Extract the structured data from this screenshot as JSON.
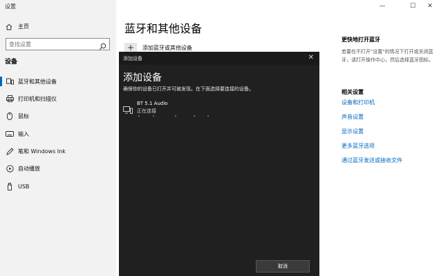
{
  "window": {
    "title": "设置",
    "controls": [
      "—",
      "☐",
      "✕"
    ]
  },
  "sidebar": {
    "home_label": "主页",
    "search_placeholder": "查找设置",
    "category": "设备",
    "items": [
      {
        "label": "蓝牙和其他设备",
        "icon": "bluetooth-devices-icon",
        "active": true
      },
      {
        "label": "打印机和扫描仪",
        "icon": "printer-icon",
        "active": false
      },
      {
        "label": "鼠标",
        "icon": "mouse-icon",
        "active": false
      },
      {
        "label": "输入",
        "icon": "keyboard-icon",
        "active": false
      },
      {
        "label": "笔和 Windows Ink",
        "icon": "pen-icon",
        "active": false
      },
      {
        "label": "自动播放",
        "icon": "autoplay-icon",
        "active": false
      },
      {
        "label": "USB",
        "icon": "usb-icon",
        "active": false
      }
    ]
  },
  "main": {
    "title": "蓝牙和其他设备",
    "add_device_label": "添加蓝牙或其他设备"
  },
  "side_panel": {
    "heading": "更快地打开蓝牙",
    "description": "若要在不打开\"设置\"的情况下打开或关闭蓝牙，请打开操作中心，然后选择蓝牙图标。",
    "related_heading": "相关设置",
    "links": [
      "设备和打印机",
      "声音设置",
      "显示设置",
      "更多蓝牙选项",
      "通过蓝牙发送或接收文件"
    ]
  },
  "dialog": {
    "window_title": "添加设备",
    "close_glyph": "✕",
    "heading": "添加设备",
    "description": "确保你的设备已打开并可被发现。在下面选择要连接的设备。",
    "device": {
      "name": "BT 5.1 Audio",
      "status": "正在连接",
      "icon": "speaker-display-icon"
    },
    "cancel_label": "取消"
  },
  "colors": {
    "accent": "#0067c0",
    "dialog_bg": "#202020",
    "sidebar_bg": "#f2f2f2",
    "progress_dots": "#3a8ee6"
  }
}
